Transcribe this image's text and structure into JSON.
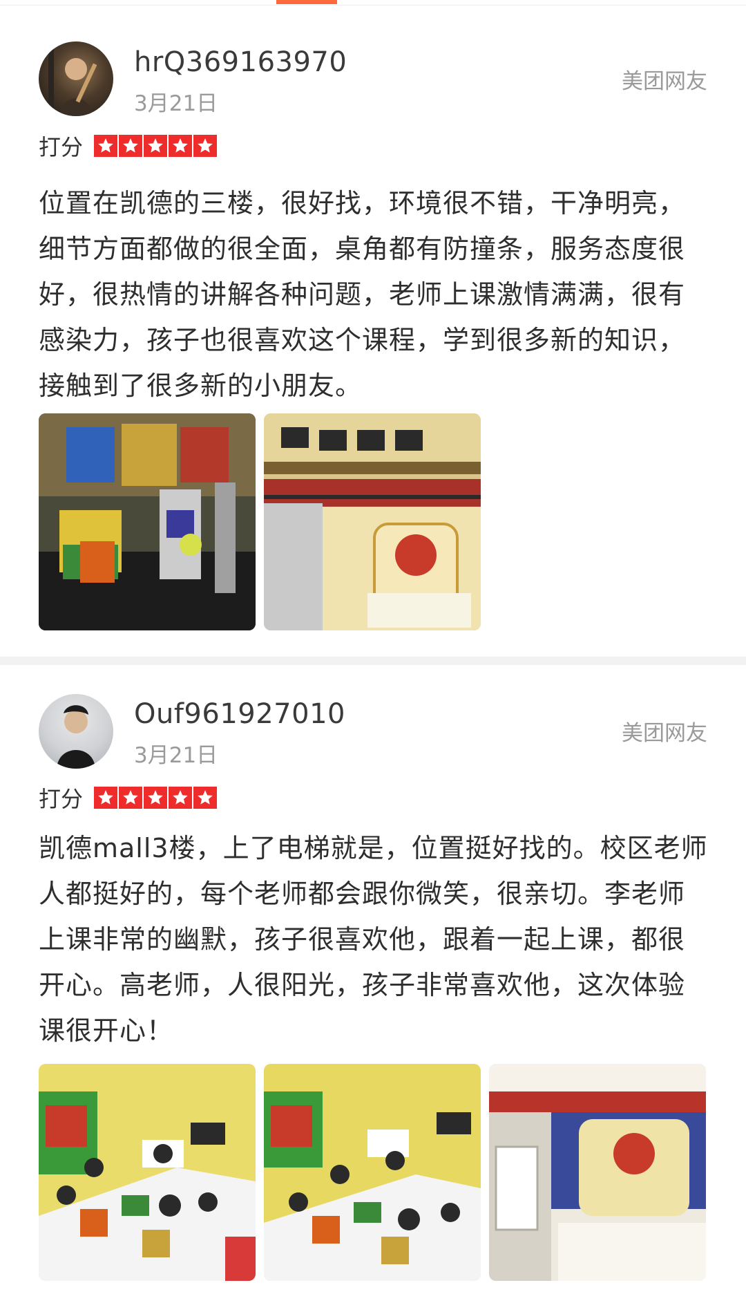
{
  "reviews": [
    {
      "username": "hrQ369163970",
      "date": "3月21日",
      "source": "美团网友",
      "rating_label": "打分",
      "rating": 5,
      "text": "位置在凯德的三楼，很好找，环境很不错，干净明亮，细节方面都做的很全面，桌角都有防撞条，服务态度很好，很热情的讲解各种问题，老师上课激情满满，很有感染力，孩子也很喜欢这个课程，学到很多新的知识，接触到了很多新的小朋友。",
      "photos": [
        "lego-robot-display-photo",
        "storefront-photo"
      ]
    },
    {
      "username": "Ouf961927010",
      "date": "3月21日",
      "source": "美团网友",
      "rating_label": "打分",
      "rating": 5,
      "text": "凯德mall3楼，上了电梯就是，位置挺好找的。校区老师人都挺好的，每个老师都会跟你微笑，很亲切。李老师上课非常的幽默，孩子很喜欢他，跟着一起上课，都很开心。高老师，人很阳光，孩子非常喜欢他，这次体验课很开心！",
      "photos": [
        "classroom-photo",
        "classroom-photo",
        "reception-desk-photo"
      ]
    }
  ],
  "colors": {
    "star": "#ef2c2c",
    "accent": "#ff6a3c",
    "muted_text": "#9a9a9a"
  }
}
